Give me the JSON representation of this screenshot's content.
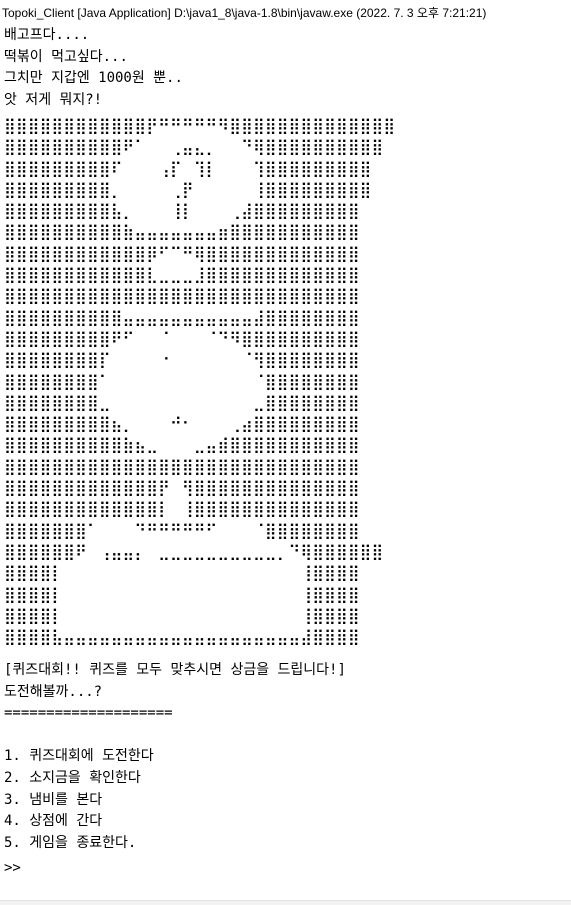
{
  "window": {
    "title": "Topoki_Client [Java Application] D:\\java1_8\\java-1.8\\bin\\javaw.exe  (2022. 7. 3 오후 7:21:21)"
  },
  "intro_lines": [
    "배고프다....",
    "떡볶이 먹고싶다...",
    "그치만 지갑엔 1000원 뿐..",
    "앗 저게 뭐지?!"
  ],
  "ascii_art": [
    "⣿⣿⣿⣿⣿⣿⣿⣿⣿⣿⣿⣿⡟⠛⠛⠛⠛⠛⠻⣿⣿⣿⣿⣿⣿⣿⣿⣿⣿⣿⣿⣿⣿",
    "⣿⣿⣿⣿⣿⣿⣿⣿⣿⣿⠟⠁⠀⠀⢀⣤⣄⡀⠀⠀⠙⢿⣿⣿⣿⣿⣿⣿⣿⣿⣿⣿",
    "⣿⣿⣿⣿⣿⣿⣿⣿⣿⠏⠀⠀⠀⢠⡏⠀⢹⡇⠀⠀⠀⢹⣿⣿⣿⣿⣿⣿⣿⣿⣿",
    "⣿⣿⣿⣿⣿⣿⣿⣿⣿⡀⠀⠀⠀⠀⢀⡟⠀⠀⠀⠀⠀⢸⣿⣿⣿⣿⣿⣿⣿⣿⣿",
    "⣿⣿⣿⣿⣿⣿⣿⣿⣿⣧⡀⠀⠀⠀⢸⡇⠀⠀⠀⢀⣼⣿⣿⣿⣿⣿⣿⣿⣿⣿",
    "⣿⣿⣿⣿⣿⣿⣿⣿⣿⣿⣷⣤⣤⣤⣤⣤⣤⣤⣶⣿⣿⣿⣿⣿⣿⣿⣿⣿⣿⣿",
    "⣿⣿⣿⣿⣿⣿⣿⣿⣿⣿⣿⣿⡿⠋⠉⠛⢿⣿⣿⣿⣿⣿⣿⣿⣿⣿⣿⣿⣿⣿",
    "⣿⣿⣿⣿⣿⣿⣿⣿⣿⣿⣿⣿⣇⣀⣀⣀⣸⣿⣿⣿⣿⣿⣿⣿⣿⣿⣿⣿⣿⣿",
    "⣿⣿⣿⣿⣿⣿⣿⣿⣿⣿⣿⣿⣿⣿⣿⣿⣿⣿⣿⣿⣿⣿⣿⣿⣿⣿⣿⣿⣿⣿",
    "⣿⣿⣿⣿⣿⣿⣿⣿⣿⣿⣤⣤⣤⣤⣤⣤⣤⣤⣤⣤⣤⣼⣿⣿⣿⣿⣿⣿⣿⣿",
    "⣿⣿⣿⣿⣿⣿⣿⣿⣿⠟⠋⠀⠀⠈⠀⠀⠀⠈⠙⠻⣿⣿⣿⣿⣿⣿⣿⣿⣿⣿",
    "⣿⣿⣿⣿⣿⣿⣿⣿⡏⠀⠀⠀⠀⠐⠀⠀⠀⠀⠀⠀⠈⢻⣿⣿⣿⣿⣿⣿⣿⣿",
    "⣿⣿⣿⣿⣿⣿⣿⣿⠁⠀⠀⠀⠀⠀⠀⠀⠀⠀⠀⠀⠀⠈⣿⣿⣿⣿⣿⣿⣿⣿",
    "⣿⣿⣿⣿⣿⣿⣿⣿⣀⠀⠀⠀⠀⠀⠀⠀⠀⠀⠀⠀⠀⣀⣿⣿⣿⣿⣿⣿⣿⣿",
    "⣿⣿⣿⣿⣿⣿⣿⣿⣿⣦⡀⠀⠀⠀⠚⠂⠀⠀⠀⢀⣴⣿⣿⣿⣿⣿⣿⣿⣿⣿",
    "⣿⣿⣿⣿⣿⣿⣿⣿⣿⣿⣷⣦⣀⠀⠀⠀⣀⣤⣾⣿⣿⣿⣿⣿⣿⣿⣿⣿⣿⣿",
    "⣿⣿⣿⣿⣿⣿⣿⣿⣿⣿⣿⣿⣿⣿⣿⣿⣿⣿⣿⣿⣿⣿⣿⣿⣿⣿⣿⣿⣿⣿",
    "⣿⣿⣿⣿⣿⣿⣿⣿⣿⣿⣿⣿⣿⡟⠀⢻⣿⣿⣿⣿⣿⣿⣿⣿⣿⣿⣿⣿⣿⣿",
    "⣿⣿⣿⣿⣿⣿⣿⣿⣿⣿⣿⣿⣿⡇⠀⢸⣿⣿⣿⣿⣿⣿⣿⣿⣿⣿⣿⣿⣿⣿",
    "⣿⣿⣿⣿⣿⣿⣿⠁⠀⠀⠀⠙⠛⠛⠛⠛⠛⠋⠀⠀⠀⠈⣿⣿⣿⣿⣿⣿⣿⣿",
    "⣿⣿⣿⣿⣿⣿⠟⠀⢠⣤⣤⡄⠀⣀⣀⣀⣀⣀⣀⣀⣀⣀⣀⡀⠙⢿⣿⣿⣿⣿⣿⣿",
    "⣿⣿⣿⣿⡇⠀⠀⠀⠀⠀⠀⠀⠀⠀⠀⠀⠀⠀⠀⠀⠀⠀⠀⠀⠀⢸⣿⣿⣿⣿",
    "⣿⣿⣿⣿⡇⠀⠀⠀⠀⠀⠀⠀⠀⠀⠀⠀⠀⠀⠀⠀⠀⠀⠀⠀⠀⢸⣿⣿⣿⣿",
    "⣿⣿⣿⣿⡇⠀⠀⠀⠀⠀⠀⠀⠀⠀⠀⠀⠀⠀⠀⠀⠀⠀⠀⠀⠀⢸⣿⣿⣿⣿",
    "⣿⣿⣿⣿⣧⣤⣤⣤⣤⣤⣤⣤⣤⣤⣤⣤⣤⣤⣤⣤⣤⣤⣤⣤⣤⣼⣿⣿⣿⣿"
  ],
  "quiz_lines": [
    "[퀴즈대회!! 퀴즈를 모두 맞추시면 상금을 드립니다!]",
    "도전해볼까...?",
    "====================",
    "",
    "1. 퀴즈대회에 도전한다",
    "2. 소지금을 확인한다",
    "3. 냄비를 본다",
    "4. 상점에 간다",
    "5. 게임을 종료한다."
  ],
  "input": {
    "prompt": ">>"
  }
}
